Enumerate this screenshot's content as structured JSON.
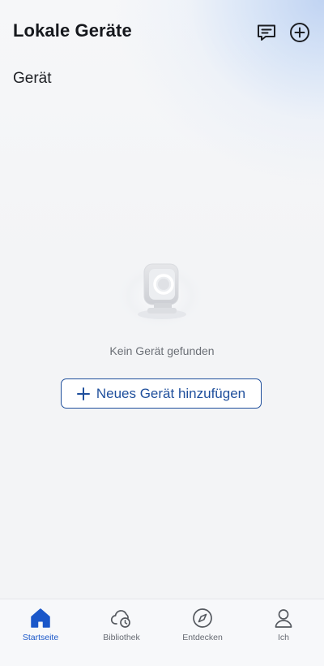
{
  "header": {
    "title": "Lokale Geräte",
    "icons": [
      "message-icon",
      "add-circle-icon"
    ]
  },
  "section": {
    "title": "Gerät"
  },
  "empty_state": {
    "illustration": "camera-device-illustration",
    "message": "Kein Gerät gefunden",
    "button_label": "Neues Gerät hinzufügen"
  },
  "tabbar": {
    "items": [
      {
        "label": "Startseite",
        "icon": "home-icon",
        "active": true
      },
      {
        "label": "Bibliothek",
        "icon": "cloud-clock-icon",
        "active": false
      },
      {
        "label": "Entdecken",
        "icon": "compass-icon",
        "active": false
      },
      {
        "label": "Ich",
        "icon": "person-icon",
        "active": false
      }
    ]
  },
  "colors": {
    "accent": "#1a57c9",
    "button_border": "#1f4f9c",
    "tab_inactive": "#666a72"
  }
}
